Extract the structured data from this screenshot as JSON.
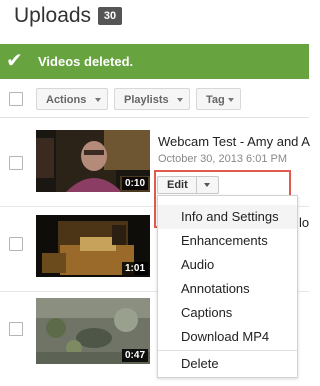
{
  "header": {
    "title": "Uploads",
    "count": "30"
  },
  "banner": {
    "icon": "check-icon",
    "check": "✔",
    "text": "Videos deleted.",
    "color": "#67a43f"
  },
  "toolbar": {
    "actions": "Actions",
    "playlists": "Playlists",
    "tag": "Tag"
  },
  "videos": [
    {
      "title": "Webcam Test - Amy and A",
      "date": "October 30, 2013 6:01 PM",
      "duration": "0:10"
    },
    {
      "title": "",
      "title_fragment": "lo",
      "duration": "1:01"
    },
    {
      "title": "",
      "duration": "0:47"
    }
  ],
  "edit": {
    "label": "Edit",
    "highlight_color": "#e05a4f",
    "menu": [
      "Info and Settings",
      "Enhancements",
      "Audio",
      "Annotations",
      "Captions",
      "Download MP4",
      "Delete"
    ]
  }
}
